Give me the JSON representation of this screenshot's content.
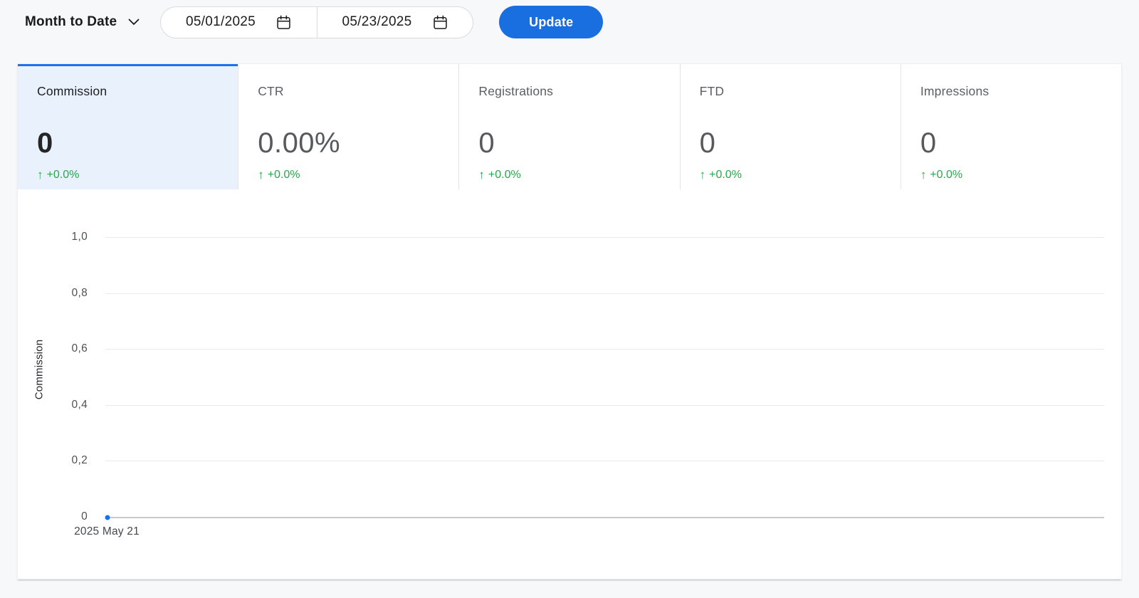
{
  "header": {
    "range_selector": {
      "label": "Month to Date"
    },
    "date_start": "05/01/2025",
    "date_end": "05/23/2025",
    "update_button": "Update"
  },
  "metric_tabs": [
    {
      "label": "Commission",
      "value": "0",
      "delta": "+0.0%",
      "active": true
    },
    {
      "label": "CTR",
      "value": "0.00%",
      "delta": "+0.0%",
      "active": false
    },
    {
      "label": "Registrations",
      "value": "0",
      "delta": "+0.0%",
      "active": false
    },
    {
      "label": "FTD",
      "value": "0",
      "delta": "+0.0%",
      "active": false
    },
    {
      "label": "Impressions",
      "value": "0",
      "delta": "+0.0%",
      "active": false
    }
  ],
  "icons": {
    "arrow_up_glyph": "↑"
  },
  "chart_data": {
    "type": "line",
    "title": "",
    "xlabel": "",
    "ylabel": "Commission",
    "ylim": [
      0,
      1.0
    ],
    "yticks": [
      "1,0",
      "0,8",
      "0,6",
      "0,4",
      "0,2",
      "0"
    ],
    "x": [
      "2025 May 21"
    ],
    "series": [
      {
        "name": "Commission",
        "values": [
          0
        ]
      }
    ],
    "grid": true,
    "legend": false,
    "point_color": "#1a73e8"
  },
  "colors": {
    "accent_blue": "#1a6fe0",
    "tab_active_border": "#1a73e8",
    "tab_active_bg": "#e9f1fc",
    "positive_green": "#2aa74d",
    "grid_line": "#e8e9ea",
    "baseline": "#c7c9cc",
    "page_bg": "#f7f8fa"
  }
}
